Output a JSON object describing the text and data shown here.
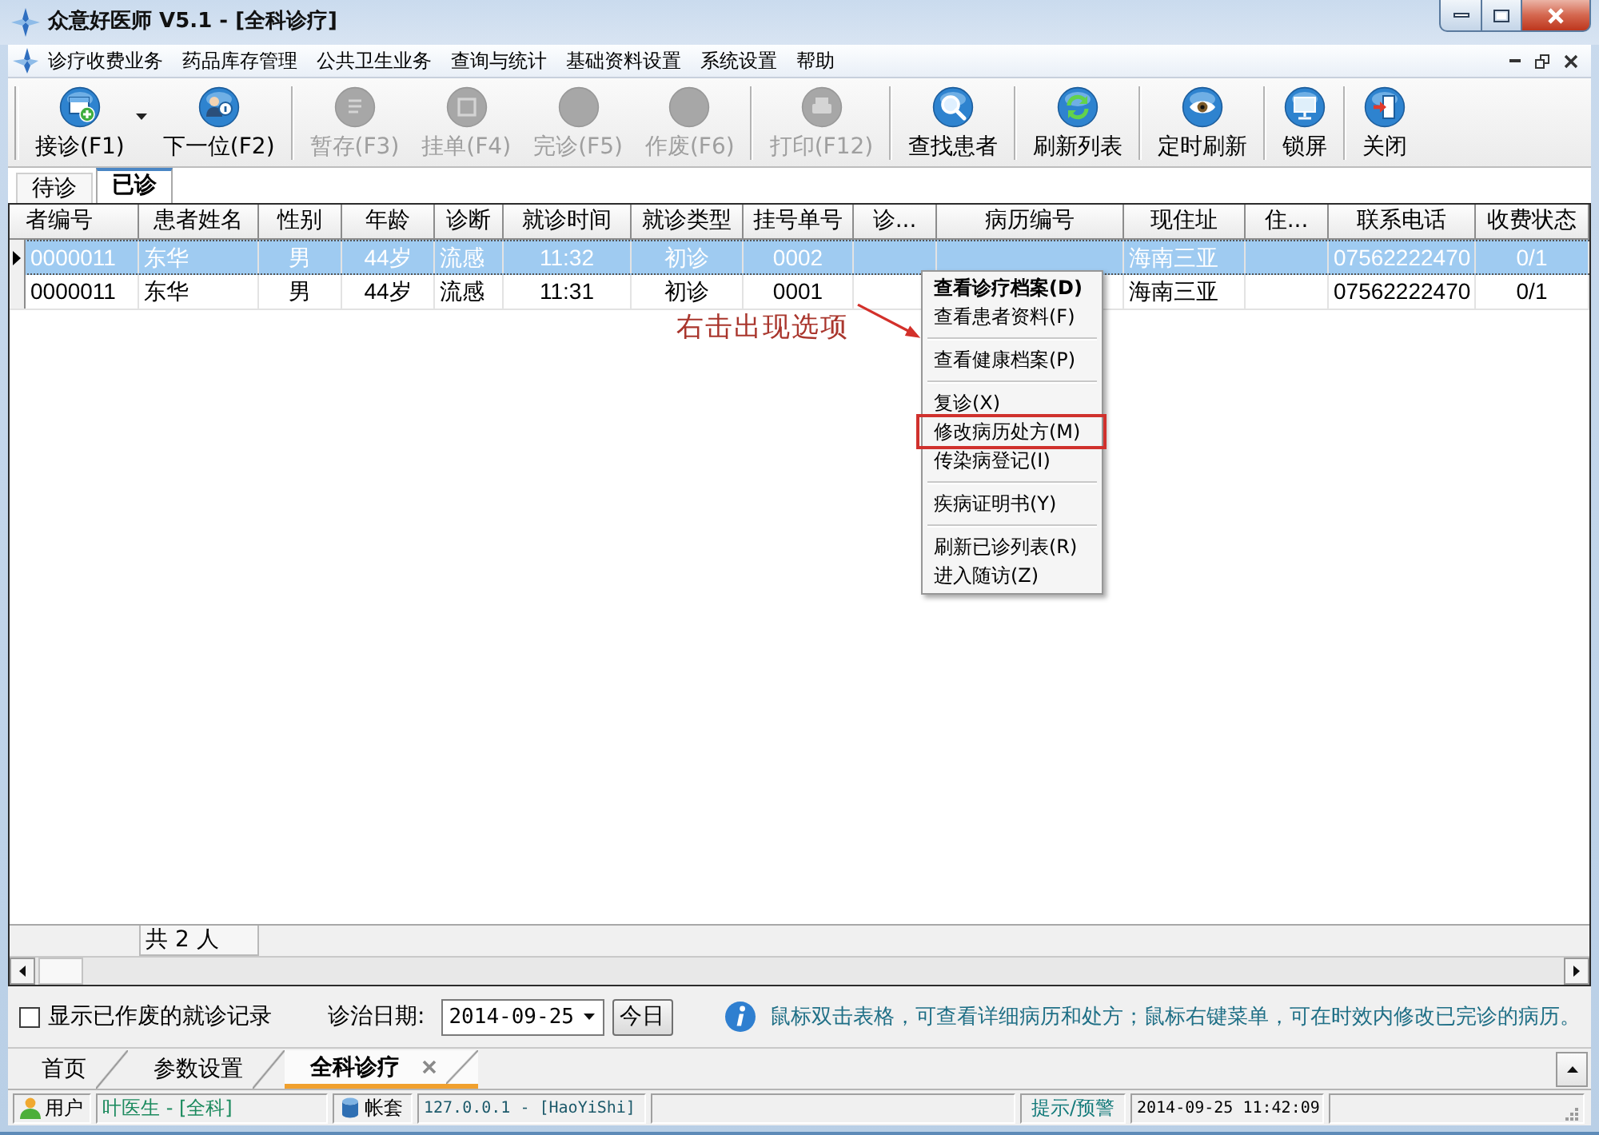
{
  "window": {
    "title": "众意好医师 V5.1 - [全科诊疗]"
  },
  "menu_bar": {
    "items": [
      "诊疗收费业务",
      "药品库存管理",
      "公共卫生业务",
      "查询与统计",
      "基础资料设置",
      "系统设置",
      "帮助"
    ]
  },
  "toolbar": {
    "groups": [
      [
        {
          "label": "接诊(F1)",
          "disabled": false,
          "dropdown": true
        },
        {
          "label": "下一位(F2)",
          "disabled": false,
          "dropdown": false
        }
      ],
      [
        {
          "label": "暂存(F3)",
          "disabled": true,
          "dropdown": false
        },
        {
          "label": "挂单(F4)",
          "disabled": true,
          "dropdown": false
        },
        {
          "label": "完诊(F5)",
          "disabled": true,
          "dropdown": false
        },
        {
          "label": "作废(F6)",
          "disabled": true,
          "dropdown": false
        }
      ],
      [
        {
          "label": "打印(F12)",
          "disabled": true,
          "dropdown": false
        }
      ],
      [
        {
          "label": "查找患者",
          "disabled": false,
          "dropdown": false
        }
      ],
      [
        {
          "label": "刷新列表",
          "disabled": false,
          "dropdown": false
        }
      ],
      [
        {
          "label": "定时刷新",
          "disabled": false,
          "dropdown": false
        }
      ],
      [
        {
          "label": "锁屏",
          "disabled": false,
          "dropdown": false
        }
      ],
      [
        {
          "label": "关闭",
          "disabled": false,
          "dropdown": false
        }
      ]
    ]
  },
  "view_tabs": [
    {
      "label": "待诊",
      "selected": false
    },
    {
      "label": "已诊",
      "selected": true
    }
  ],
  "table": {
    "columns": [
      "者编号",
      "患者姓名",
      "性别",
      "年龄",
      "诊断",
      "就诊时间",
      "就诊类型",
      "挂号单号",
      "诊...",
      "病历编号",
      "现住址",
      "住...",
      "联系电话",
      "收费状态"
    ],
    "rows": [
      {
        "selected": true,
        "cells": [
          "0000011",
          "东华",
          "男",
          "44岁",
          "流感",
          "11:32",
          "初诊",
          "0002",
          null,
          null,
          "海南三亚",
          null,
          "07562222470",
          "0/1"
        ]
      },
      {
        "selected": false,
        "cells": [
          "0000011",
          "东华",
          "男",
          "44岁",
          "流感",
          "11:31",
          "初诊",
          "0001",
          null,
          null,
          "海南三亚",
          null,
          "07562222470",
          "0/1"
        ]
      }
    ],
    "summary": "共 2 人"
  },
  "context_menu": {
    "groups": [
      [
        {
          "label": "查看诊疗档案(D)",
          "default": true,
          "boxed": false
        },
        {
          "label": "查看患者资料(F)",
          "default": false,
          "boxed": false
        }
      ],
      [
        {
          "label": "查看健康档案(P)",
          "default": false,
          "boxed": false
        }
      ],
      [
        {
          "label": "复诊(X)",
          "default": false,
          "boxed": false
        },
        {
          "label": "修改病历处方(M)",
          "default": false,
          "boxed": true
        },
        {
          "label": "传染病登记(I)",
          "default": false,
          "boxed": false
        }
      ],
      [
        {
          "label": "疾病证明书(Y)",
          "default": false,
          "boxed": false
        }
      ],
      [
        {
          "label": "刷新已诊列表(R)",
          "default": false,
          "boxed": false
        },
        {
          "label": "进入随访(Z)",
          "default": false,
          "boxed": false
        }
      ]
    ]
  },
  "annotation": {
    "text": "右击出现选项"
  },
  "filter_bar": {
    "show_voided": {
      "label": "显示已作废的就诊记录",
      "checked": false
    },
    "date_label": "诊治日期:",
    "date_value": "2014-09-25",
    "today_button": "今日",
    "hint": "鼠标双击表格，可查看详细病历和处方；鼠标右键菜单，可在时效内修改已完诊的病历。"
  },
  "document_tabs": [
    {
      "label": "首页",
      "selected": false,
      "closable": false
    },
    {
      "label": "参数设置",
      "selected": false,
      "closable": false
    },
    {
      "label": "全科诊疗",
      "selected": true,
      "closable": true
    }
  ],
  "status_bar": {
    "user_label": "用户",
    "user_value": "叶医生 - [全科]",
    "account_label": "帐套",
    "account_value": "127.0.0.1 - [HaoYiShi]",
    "alerts": "提示/预警",
    "datetime": "2014-09-25 11:42:09"
  }
}
